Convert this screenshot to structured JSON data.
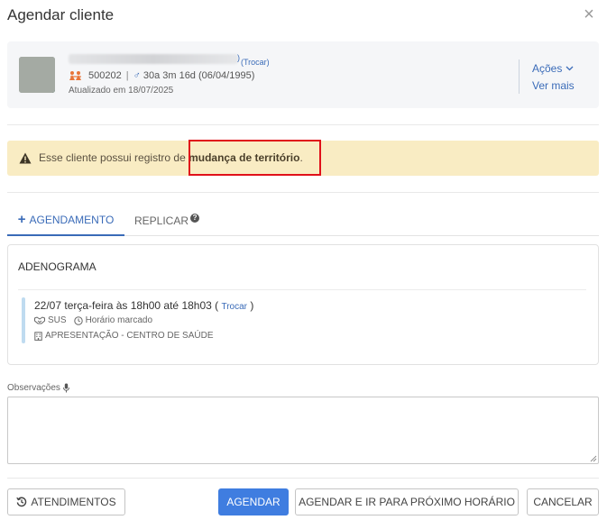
{
  "modal": {
    "title": "Agendar cliente",
    "close_label": "×"
  },
  "patient": {
    "name_suffix": ")",
    "change_link": "(Trocar)",
    "id": "500202",
    "separator": "|",
    "gender_symbol": "♂",
    "age": "30a 3m 16d (06/04/1995)",
    "updated": "Atualizado em 18/07/2025",
    "actions_label": "Ações",
    "see_more_label": "Ver mais"
  },
  "alert": {
    "text_prefix": "Esse cliente possui registro de ",
    "text_bold": "mudança de território",
    "text_suffix": ".",
    "color": "#f9ecc3"
  },
  "tabs": [
    {
      "icon": "+",
      "label": "AGENDAMENTO",
      "active": true
    },
    {
      "label": "REPLICAR",
      "help_icon": "?"
    }
  ],
  "schedule": {
    "procedure": "ADENOGRAMA",
    "time_text": "22/07 terça-feira às 18h00 até 18h03 (",
    "change_link": "Trocar",
    "time_close": ")",
    "coverage": "SUS",
    "slot_type": "Horário marcado",
    "location": "APRESENTAÇÃO - CENTRO DE SAÚDE"
  },
  "observations": {
    "label": "Observações",
    "value": ""
  },
  "footer": {
    "atendimentos_label": "ATENDIMENTOS",
    "agendar_label": "AGENDAR",
    "proximo_label": "AGENDAR E IR PARA PRÓXIMO HORÁRIO",
    "cancelar_label": "CANCELAR"
  },
  "colors": {
    "primary": "#3f7de0",
    "link": "#3a6bb8",
    "highlight": "#e0101a"
  }
}
